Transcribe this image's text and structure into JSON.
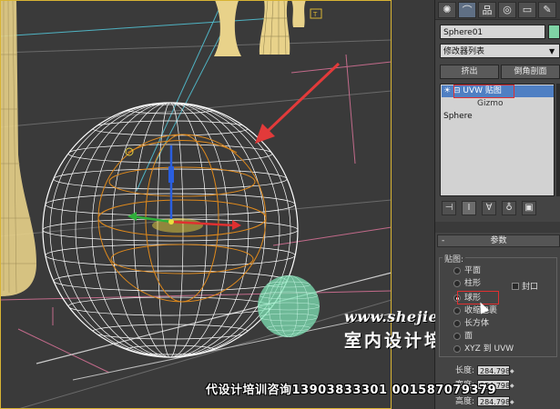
{
  "viewport": {
    "label_box": "T",
    "watermark_url": "www.shejiedu.com",
    "watermark_title": "室内设计培训",
    "footer": "代设计培训咨询13903833301 001587079379",
    "colors": {
      "border": "#d8b434",
      "sphere": "#ffffff",
      "gizmo": "#e08a1c",
      "arrow": "#e23a3a",
      "small_sphere": "#7fe3b5",
      "vase": "#e8d28a"
    }
  },
  "panel": {
    "tabs": [
      {
        "name": "create",
        "icon": "✺"
      },
      {
        "name": "modify",
        "icon": "⌒"
      },
      {
        "name": "hierarchy",
        "icon": "品"
      },
      {
        "name": "motion",
        "icon": "◎"
      },
      {
        "name": "display",
        "icon": "▭"
      },
      {
        "name": "utilities",
        "icon": "✎"
      }
    ],
    "object_name": "Sphere01",
    "modifier_list": "修改器列表",
    "buttons": {
      "extrude": "挤出",
      "bevel": "倒角剖面"
    },
    "stack": {
      "items": [
        {
          "label": "UVW 贴图",
          "selected": true
        },
        {
          "label": "Gizmo"
        },
        {
          "label": "Sphere"
        }
      ]
    },
    "tools": [
      "⊣",
      "Ⅰ",
      "∀",
      "♁",
      "▣"
    ],
    "rollout_title": "参数",
    "mapping_label": "贴图:",
    "mapping_options": [
      {
        "label": "平面",
        "checked": false
      },
      {
        "label": "柱形",
        "checked": false
      },
      {
        "label": "球形",
        "checked": true
      },
      {
        "label": "收缩包裹",
        "checked": false
      },
      {
        "label": "长方体",
        "checked": false
      },
      {
        "label": "面",
        "checked": false
      },
      {
        "label": "XYZ 到 UVW",
        "checked": false
      }
    ],
    "cap_label": "封口",
    "params": [
      {
        "label": "长度:",
        "value": "284.798"
      },
      {
        "label": "宽度:",
        "value": "284.798"
      },
      {
        "label": "高度:",
        "value": "284.798"
      }
    ],
    "colors": {
      "accent": "#4f7fc3",
      "highlight": "#e03030",
      "object_color": "#7fd3a5"
    }
  }
}
